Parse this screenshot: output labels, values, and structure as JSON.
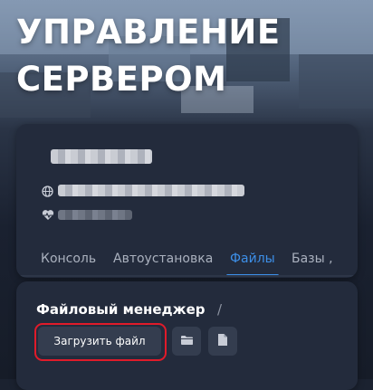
{
  "page": {
    "title_line1": "УПРАВЛЕНИЕ",
    "title_line2": "СЕРВЕРОМ"
  },
  "server": {
    "tabs": [
      {
        "label": "Консоль",
        "active": false
      },
      {
        "label": "Автоустановка",
        "active": false
      },
      {
        "label": "Файлы",
        "active": true
      },
      {
        "label": "Базы ,",
        "active": false
      }
    ],
    "icons": {
      "address": "globe-icon",
      "status": "heartbeat-icon"
    }
  },
  "file_manager": {
    "title": "Файловый менеджер",
    "path_separator": "/",
    "upload_label": "Загрузить файл",
    "icons": {
      "new_folder": "folder-icon",
      "new_file": "file-icon"
    }
  },
  "colors": {
    "accent": "#3d8fe8",
    "highlight": "#e01b2a",
    "card": "#232b3c",
    "button": "#343d4f"
  }
}
